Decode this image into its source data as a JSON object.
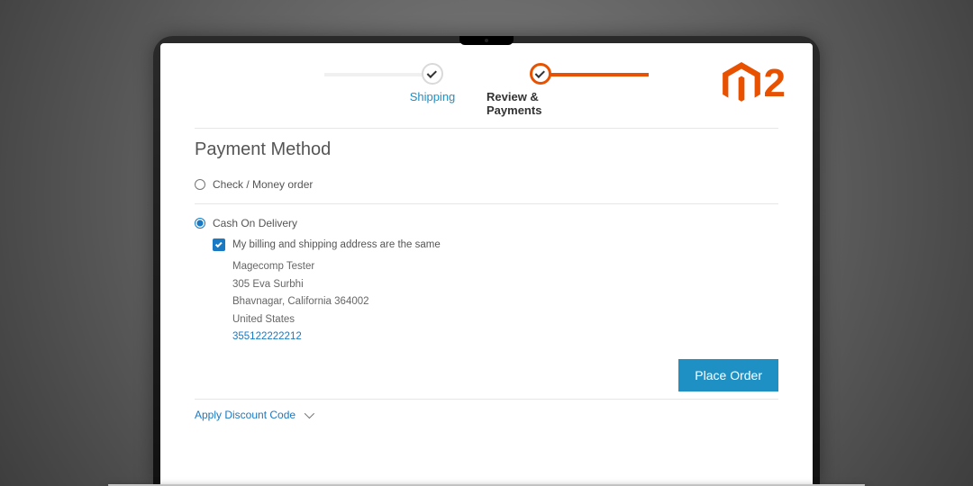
{
  "logo": {
    "version_text": "2",
    "brand_color": "#e85100"
  },
  "stepper": {
    "step1": {
      "label": "Shipping",
      "state": "completed"
    },
    "step2": {
      "label": "Review & Payments",
      "state": "active"
    }
  },
  "section": {
    "title": "Payment Method"
  },
  "payment_options": {
    "opt1": {
      "label": "Check / Money order",
      "selected": false
    },
    "opt2": {
      "label": "Cash On Delivery",
      "selected": true
    }
  },
  "billing": {
    "same_label": "My billing and shipping address are the same",
    "same_checked": true,
    "address": {
      "name": "Magecomp Tester",
      "street": "305 Eva Surbhi",
      "city_region_zip": "Bhavnagar, California 364002",
      "country": "United States",
      "phone": "355122222212"
    }
  },
  "actions": {
    "place_order": "Place Order"
  },
  "discount": {
    "label": "Apply Discount Code"
  }
}
